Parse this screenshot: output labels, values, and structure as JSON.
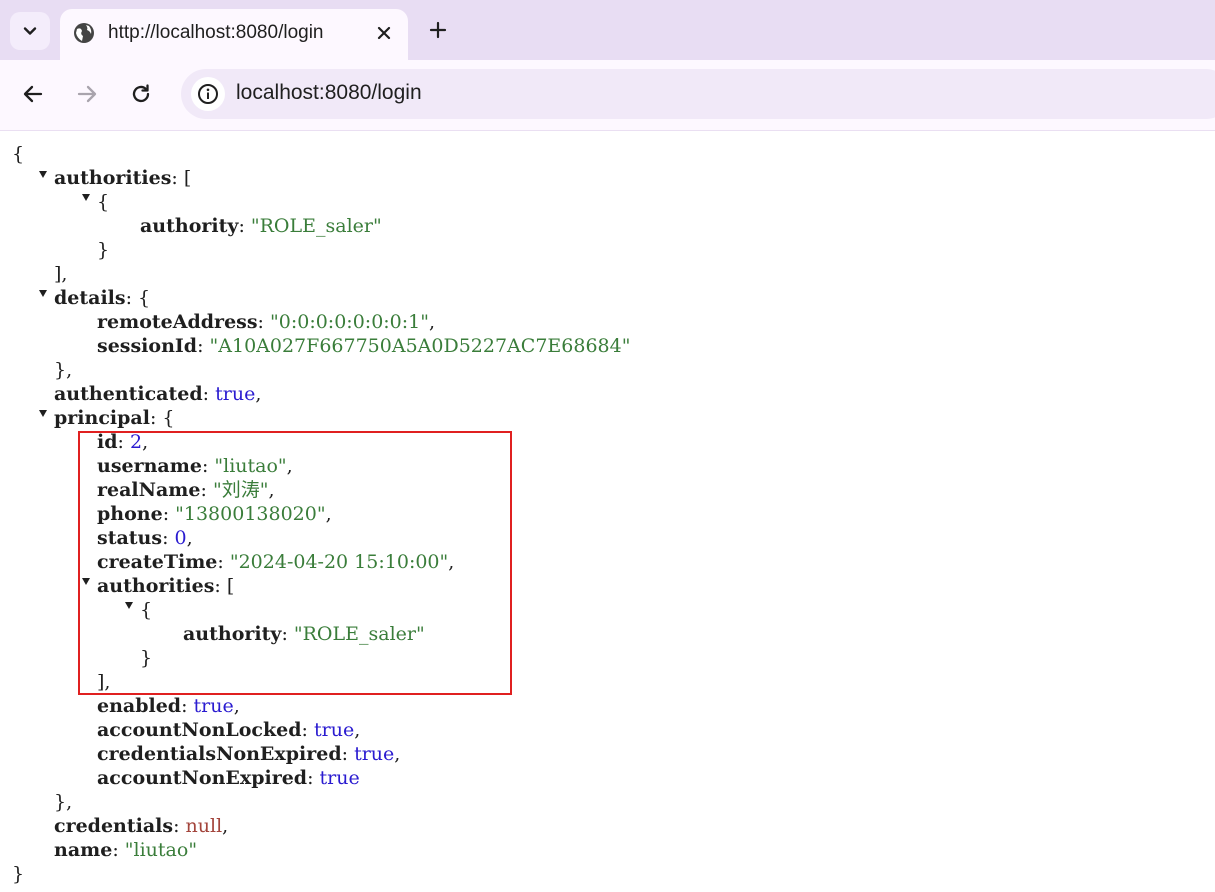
{
  "browser": {
    "tab": {
      "title": "http://localhost:8080/login",
      "favicon": "globe-icon"
    },
    "url": "localhost:8080/login",
    "icons": {
      "tab_menu": "chevron-down-icon",
      "close": "close-icon",
      "new_tab": "plus-icon",
      "back": "back-arrow-icon",
      "forward": "forward-arrow-icon",
      "reload": "reload-icon",
      "site_info": "info-icon"
    }
  },
  "json": {
    "open_brace": "{",
    "close_brace": "}",
    "authorities_key": "authorities",
    "authorities_open": ": [",
    "auth_item_open": "{",
    "auth_item_key": "authority",
    "auth_item_value": "\"ROLE_saler\"",
    "auth_item_close": "}",
    "authorities_close": "],",
    "details_key": "details",
    "details_open": ": {",
    "remote_key": "remoteAddress",
    "remote_value": "\"0:0:0:0:0:0:0:1\"",
    "session_key": "sessionId",
    "session_value": "\"A10A027F667750A5A0D5227AC7E68684\"",
    "details_close": "},",
    "authenticated_key": "authenticated",
    "authenticated_value": "true",
    "principal_key": "principal",
    "principal_open": ": {",
    "id_key": "id",
    "id_value": "2",
    "username_key": "username",
    "username_value": "\"liutao\"",
    "realname_key": "realName",
    "realname_value": "\"刘涛\"",
    "phone_key": "phone",
    "phone_value": "\"13800138020\"",
    "status_key": "status",
    "status_value": "0",
    "createtime_key": "createTime",
    "createtime_value": "\"2024-04-20 15:10:00\"",
    "p_authorities_key": "authorities",
    "p_authorities_open": ": [",
    "p_auth_item_open": "{",
    "p_auth_item_key": "authority",
    "p_auth_item_value": "\"ROLE_saler\"",
    "p_auth_item_close": "}",
    "p_authorities_close": "],",
    "enabled_key": "enabled",
    "enabled_value": "true",
    "acct_nonlocked_key": "accountNonLocked",
    "acct_nonlocked_value": "true",
    "cred_nonexpired_key": "credentialsNonExpired",
    "cred_nonexpired_value": "true",
    "acct_nonexpired_key": "accountNonExpired",
    "acct_nonexpired_value": "true",
    "principal_close": "},",
    "credentials_key": "credentials",
    "credentials_value": "null",
    "name_key": "name",
    "name_value": "\"liutao\"",
    "sep_colon": ": ",
    "sep_comma": ","
  },
  "colors": {
    "highlight_box": "#e02020",
    "string": "#3a7d3a",
    "number_boolean": "#2a1bd0",
    "null": "#a3453c",
    "tabstrip": "#e8ddf3"
  }
}
